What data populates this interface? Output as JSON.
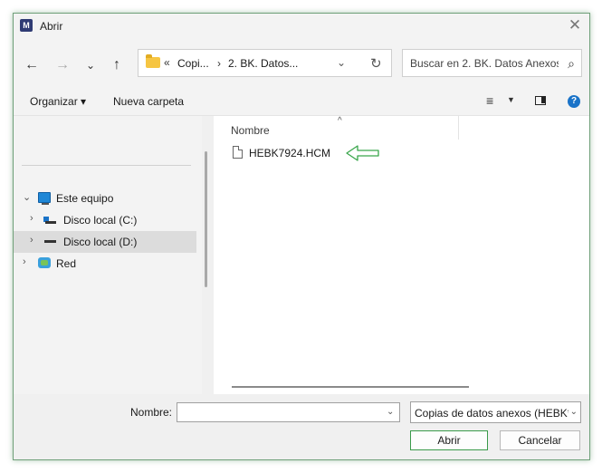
{
  "window": {
    "title": "Abrir",
    "app_icon_letter": "M",
    "close_glyph": "✕"
  },
  "nav": {
    "back": "←",
    "forward": "→",
    "recent": "⌄",
    "up": "↑"
  },
  "address": {
    "prefix_glyph": "«",
    "crumbs": [
      "Copi...",
      "2. BK. Datos..."
    ],
    "separator": "›",
    "dropdown": "⌄",
    "refresh": "↻"
  },
  "search": {
    "placeholder": "Buscar en 2. BK. Datos Anexos...",
    "icon": "⌕"
  },
  "toolbar": {
    "organize": "Organizar ▾",
    "new_folder": "Nueva carpeta",
    "view_glyph": "≡",
    "view_dd": "▼",
    "help": "?"
  },
  "sidebar": {
    "items": [
      {
        "label": "Este equipo",
        "expander": "⌄",
        "icon": "monitor-icon"
      },
      {
        "label": "Disco local (C:)",
        "expander": "›",
        "icon": "drive-icon"
      },
      {
        "label": "Disco local (D:)",
        "expander": "›",
        "icon": "drive-icon",
        "selected": true
      },
      {
        "label": "Red",
        "expander": "›",
        "icon": "network-icon"
      }
    ]
  },
  "files": {
    "column_name": "Nombre",
    "sort_glyph": "^",
    "items": [
      {
        "name": "HEBK7924.HCM",
        "icon": "file-icon"
      }
    ]
  },
  "bottom": {
    "name_label": "Nombre:",
    "name_value": "",
    "name_dd": "⌄",
    "filter_value": "Copias de datos anexos (HEBK*",
    "filter_dd": "⌄",
    "open_label": "Abrir",
    "cancel_label": "Cancelar"
  },
  "colors": {
    "accent": "#1a73c8",
    "highlight_arrow": "#3aa64c",
    "selected_row": "#dcdcdc"
  }
}
